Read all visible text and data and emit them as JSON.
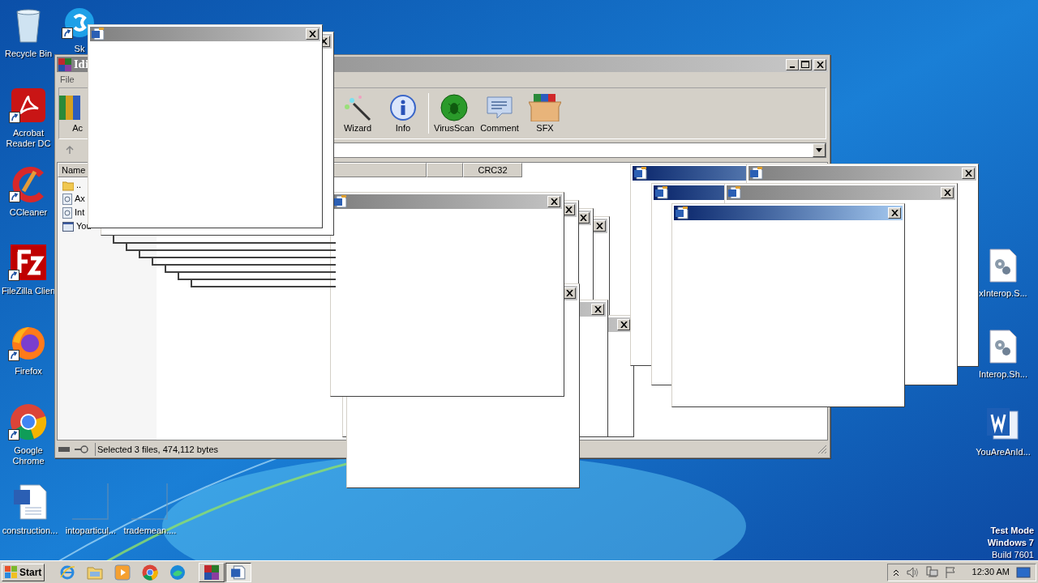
{
  "desktop_icons": [
    {
      "label": "Recycle Bin",
      "kind": "recycle",
      "shortcut": false
    },
    {
      "label": "Sk",
      "kind": "skype",
      "shortcut": true
    },
    {
      "label": "Acrobat Reader DC",
      "kind": "acrobat",
      "shortcut": true
    },
    {
      "label": "CCleaner",
      "kind": "ccleaner",
      "shortcut": true
    },
    {
      "label": "FileZilla Clien",
      "kind": "filezilla",
      "shortcut": true
    },
    {
      "label": "Firefox",
      "kind": "firefox",
      "shortcut": true
    },
    {
      "label": "Google Chrome",
      "kind": "chrome",
      "shortcut": true
    },
    {
      "label": "construction...",
      "kind": "worddoc",
      "shortcut": false
    },
    {
      "label": "intoparticul...",
      "kind": "blank",
      "shortcut": false
    },
    {
      "label": "trademean....",
      "kind": "blank",
      "shortcut": false
    },
    {
      "label": "xInterop.S...",
      "kind": "config",
      "shortcut": false
    },
    {
      "label": "Interop.Sh...",
      "kind": "config",
      "shortcut": false
    },
    {
      "label": "YouAreAnId...",
      "kind": "word",
      "shortcut": false
    }
  ],
  "winrar": {
    "title": "Idi",
    "menu": [
      "File"
    ],
    "toolbar": [
      {
        "label": "Ac",
        "kind": "add"
      },
      {
        "label": "Wizard",
        "kind": "wizard"
      },
      {
        "label": "Info",
        "kind": "info"
      },
      {
        "label": "VirusScan",
        "kind": "virusscan"
      },
      {
        "label": "Comment",
        "kind": "comment"
      },
      {
        "label": "SFX",
        "kind": "sfx"
      }
    ],
    "columns": [
      {
        "label": "Name"
      },
      {
        "label": "CRC32"
      }
    ],
    "rows": [
      {
        "name": "..",
        "kind": "folder"
      },
      {
        "name": "Ax",
        "kind": "dll"
      },
      {
        "name": "Int",
        "kind": "dll"
      },
      {
        "name": "You",
        "kind": "exe"
      }
    ],
    "status_bar": "Selected 3 files, 474,112 bytes"
  },
  "popups": [
    {
      "active": false
    },
    {
      "active": false
    },
    {
      "active": false
    },
    {
      "active": false
    },
    {
      "active": false
    },
    {
      "active": false
    },
    {
      "active": true
    },
    {
      "active": false
    },
    {
      "active": true
    },
    {
      "active": false
    },
    {
      "active": true
    },
    {
      "active": false
    },
    {
      "active": false
    },
    {
      "active": false
    }
  ],
  "taskbar": {
    "start": "Start",
    "quick_launch": [
      {
        "kind": "ie"
      },
      {
        "kind": "explorer"
      },
      {
        "kind": "media"
      },
      {
        "kind": "chrome"
      },
      {
        "kind": "edge"
      }
    ],
    "tasks": [
      {
        "kind": "winrar",
        "selected": false
      },
      {
        "kind": "word",
        "selected": true
      }
    ],
    "clock": "12:30 AM"
  },
  "os_notice": [
    "Test Mode",
    "Windows 7",
    "Build 7601"
  ]
}
